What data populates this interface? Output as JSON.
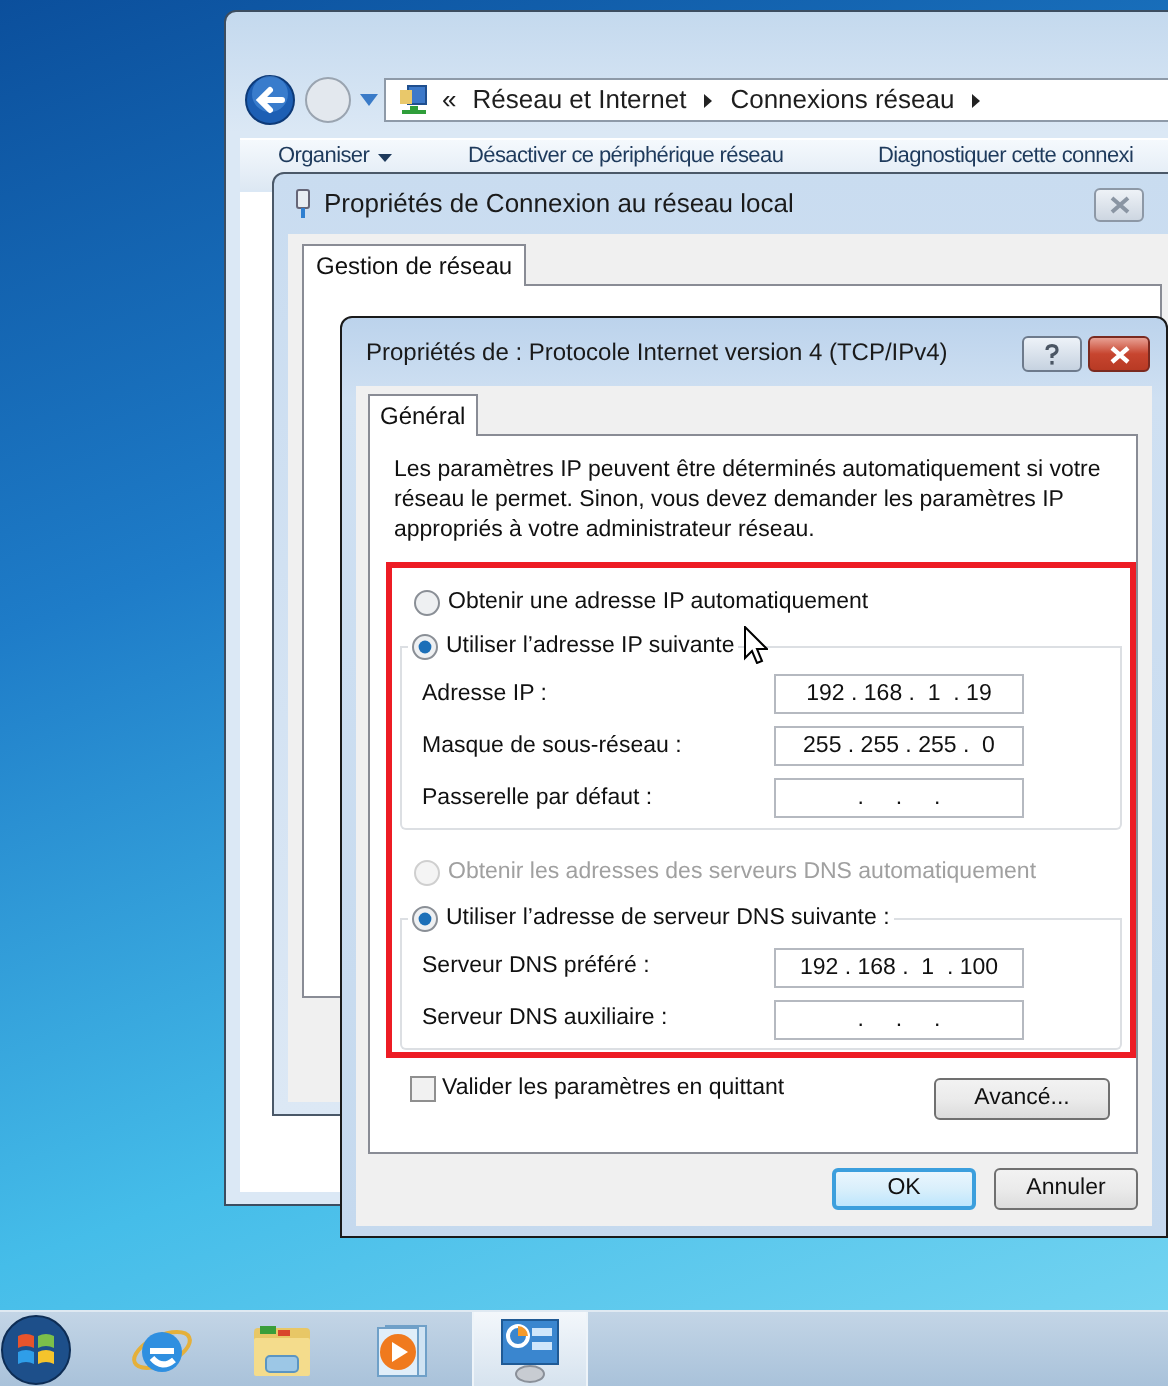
{
  "explorer": {
    "nav_chevron": "«",
    "breadcrumbs": [
      "Réseau et Internet",
      "Connexions réseau"
    ],
    "toolbar": [
      {
        "label": "Organiser",
        "menu": true
      },
      {
        "label": "Désactiver ce périphérique réseau",
        "menu": false
      },
      {
        "label": "Diagnostiquer cette connexi",
        "menu": false
      }
    ]
  },
  "connection_dialog": {
    "title": "Propriétés de Connexion au réseau local",
    "tabs": [
      {
        "label": "Gestion de réseau",
        "selected": true
      }
    ]
  },
  "ipv4_dialog": {
    "title": "Propriétés de : Protocole Internet version 4 (TCP/IPv4)",
    "tabs": [
      {
        "label": "Général",
        "selected": true
      }
    ],
    "description": "Les paramètres IP peuvent être déterminés automatiquement si votre réseau le permet. Sinon, vous devez demander les paramètres IP appropriés à votre administrateur réseau.",
    "ip_options": [
      {
        "label": "Obtenir une adresse IP automatiquement",
        "selected": false,
        "disabled": false
      },
      {
        "label": "Utiliser l’adresse IP suivante",
        "selected": true,
        "disabled": false
      }
    ],
    "ip_fields": [
      {
        "label": "Adresse IP :",
        "value": "192 . 168 .  1  . 19"
      },
      {
        "label": "Masque de sous-réseau :",
        "value": "255 . 255 . 255 .  0"
      },
      {
        "label": "Passerelle par défaut :",
        "value": ".     .     ."
      }
    ],
    "dns_options": [
      {
        "label": "Obtenir les adresses des serveurs DNS automatiquement",
        "selected": false,
        "disabled": true
      },
      {
        "label": "Utiliser l’adresse de serveur DNS suivante :",
        "selected": true,
        "disabled": false
      }
    ],
    "dns_fields": [
      {
        "label": "Serveur DNS préféré :",
        "value": "192 . 168 .  1  . 100"
      },
      {
        "label": "Serveur DNS auxiliaire :",
        "value": ".     .     ."
      }
    ],
    "validate_on_exit": {
      "label": "Valider les paramètres en quittant",
      "checked": false
    },
    "advanced_button": "Avancé...",
    "buttons": [
      {
        "label": "OK",
        "default": true
      },
      {
        "label": "Annuler",
        "default": false
      }
    ]
  },
  "taskbar": {
    "items": [
      {
        "kind": "start",
        "selected": false
      },
      {
        "kind": "browser",
        "selected": false
      },
      {
        "kind": "folder",
        "selected": false
      },
      {
        "kind": "media",
        "selected": false
      },
      {
        "kind": "network",
        "selected": true
      }
    ]
  }
}
